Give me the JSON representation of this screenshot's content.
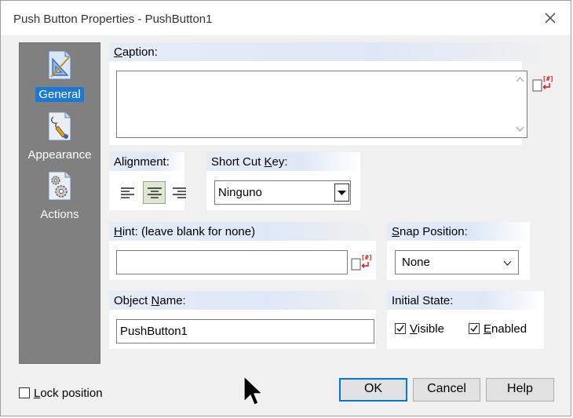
{
  "window": {
    "title": "Push Button Properties - PushButton1"
  },
  "sidebar": {
    "items": [
      {
        "label": "General",
        "selected": true,
        "icon": "drafting-triangle-icon"
      },
      {
        "label": "Appearance",
        "selected": false,
        "icon": "paint-brush-icon"
      },
      {
        "label": "Actions",
        "selected": false,
        "icon": "gears-icon"
      }
    ]
  },
  "caption": {
    "label_u": "C",
    "label_rest": "aption:",
    "value": ""
  },
  "alignment": {
    "label": "Alignment:",
    "selected": "center"
  },
  "shortcut": {
    "label_pre": "Short Cut ",
    "label_u": "K",
    "label_post": "ey:",
    "value": "Ninguno"
  },
  "hint": {
    "label_u": "H",
    "label_rest": "int: (leave blank for none)",
    "value": ""
  },
  "snap": {
    "label_u": "S",
    "label_rest": "nap Position:",
    "value": "None"
  },
  "object_name": {
    "label_pre": "Object ",
    "label_u": "N",
    "label_post": "ame:",
    "value": "PushButton1"
  },
  "initial_state": {
    "label": "Initial State:",
    "visible": {
      "label_u": "V",
      "label_rest": "isible",
      "checked": true
    },
    "enabled": {
      "label_u": "E",
      "label_rest": "nabled",
      "checked": true
    }
  },
  "lock": {
    "label_u": "L",
    "label_rest": "ock position",
    "checked": false
  },
  "buttons": {
    "ok": "OK",
    "cancel": "Cancel",
    "help": "Help"
  },
  "colors": {
    "selection": "#1a78d7",
    "sidebar": "#808080",
    "header_tint": "#dde8f6",
    "default_button_border": "#0078d7"
  }
}
